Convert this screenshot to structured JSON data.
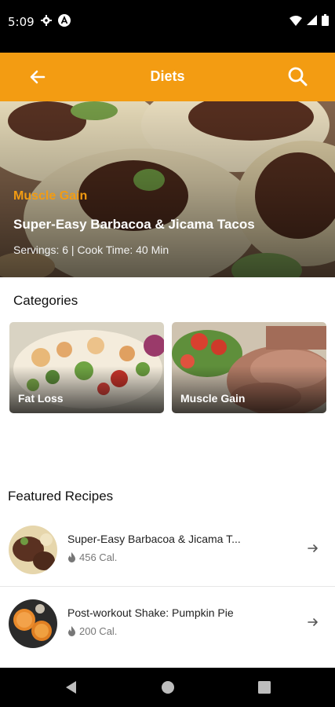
{
  "status_bar": {
    "time": "5:09"
  },
  "app_bar": {
    "title": "Diets"
  },
  "hero": {
    "tag": "Muscle Gain",
    "title": "Super-Easy Barbacoa & Jicama Tacos",
    "meta": "Servings: 6 | Cook Time: 40 Min"
  },
  "categories": {
    "heading": "Categories",
    "items": [
      {
        "label": "Fat Loss"
      },
      {
        "label": "Muscle Gain"
      }
    ]
  },
  "featured": {
    "heading": "Featured Recipes",
    "items": [
      {
        "name": "Super-Easy Barbacoa & Jicama T...",
        "calories": "456 Cal."
      },
      {
        "name": "Post-workout Shake: Pumpkin Pie",
        "calories": "200 Cal."
      }
    ]
  },
  "colors": {
    "accent": "#F39C12",
    "status_bar": "#000000"
  },
  "icons": [
    "back-arrow-icon",
    "search-icon",
    "flame-icon",
    "chevron-right-icon"
  ]
}
